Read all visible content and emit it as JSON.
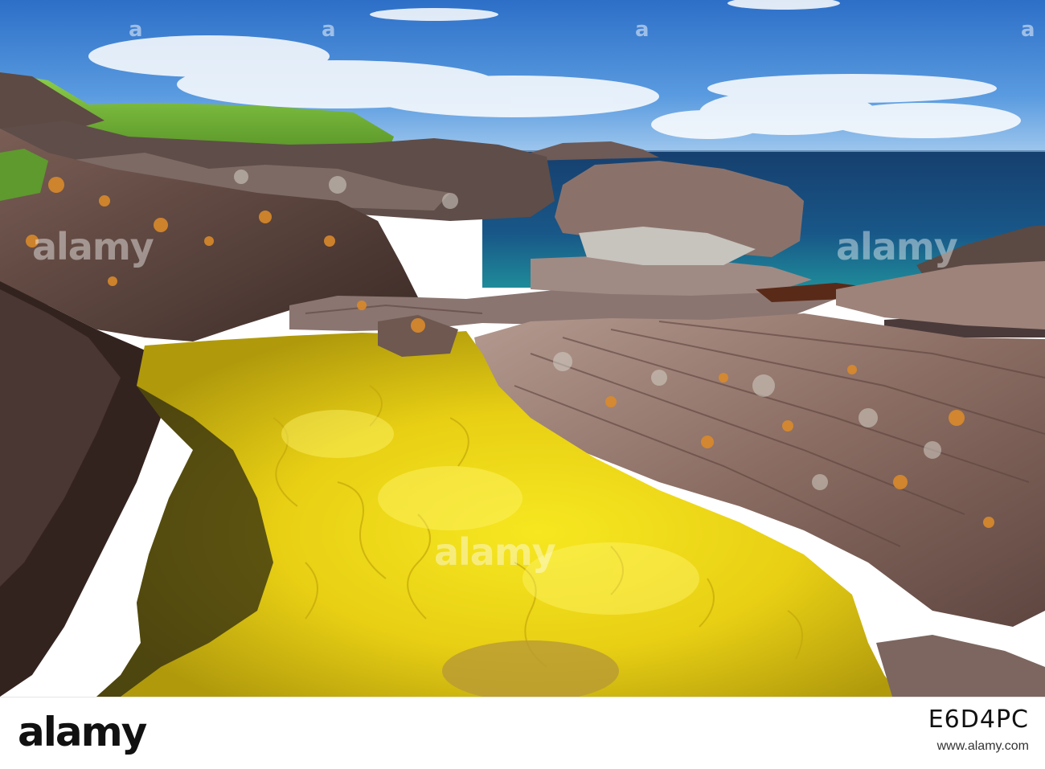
{
  "scene": {
    "description_colors": {
      "sky_top": "#2f72c9",
      "sky_horizon": "#9cc6ee",
      "sea": "#13426f",
      "sea_shallow": "#1f8a9a",
      "grass": "#7bbf3a",
      "rock": "#6b5048",
      "rock_light": "#a88c82",
      "lichen": "#d9892a",
      "weed_bright": "#f2e21a",
      "weed_dark": "#8c8a10"
    }
  },
  "watermark": {
    "text": "alamy",
    "letter": "a"
  },
  "footer": {
    "logo": "alamy",
    "image_id": "E6D4PC",
    "site": "www.alamy.com"
  }
}
